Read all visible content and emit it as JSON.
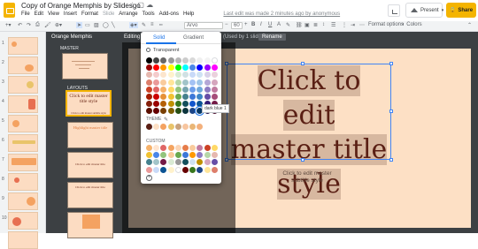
{
  "app": {
    "doc_title": "Copy of Orange Memphis by Slidesgo",
    "menu": [
      "File",
      "Edit",
      "View",
      "Insert",
      "Format",
      "Slide",
      "Arrange",
      "Tools",
      "Add-ons",
      "Help"
    ],
    "last_edit": "Last edit was made 2 minutes ago by anonymous",
    "present_label": "Present",
    "share_label": "Share"
  },
  "toolbar": {
    "font": "Arvo",
    "font_size": "60",
    "format_options": "Format options",
    "colors": "Colors"
  },
  "slides": {
    "numbers": [
      "1",
      "2",
      "3",
      "4",
      "5",
      "6",
      "7",
      "8",
      "9",
      "10"
    ]
  },
  "master": {
    "name": "Orange Memphis",
    "editing_prefix": "Editing",
    "used_text": "(Used by 1 slide)",
    "rename_label": "Rename",
    "section_master": "MASTER",
    "section_layouts": "LAYOUTS",
    "thumb_title": "Click to edit master title style",
    "thumb_subtitle": "Click to edit master subtitle style",
    "thumb_text": "Click to edit master title",
    "thumb_highlight": "Highlight master title"
  },
  "slide": {
    "title_lines": [
      "Click to edit",
      "master title",
      "style"
    ],
    "subtitle_lines": [
      "Click to edit master",
      "subtitle style"
    ],
    "bg_color": "#fde0c5",
    "title_color": "#5a1f14"
  },
  "color_picker": {
    "tab_solid": "Solid",
    "tab_gradient": "Gradient",
    "transparent_label": "Transparent",
    "theme_label": "THEME",
    "custom_label": "CUSTOM",
    "tooltip": "dark blue 1",
    "grid": [
      [
        "#000000",
        "#434343",
        "#666666",
        "#999999",
        "#b7b7b7",
        "#cccccc",
        "#d9d9d9",
        "#efefef",
        "#f3f3f3",
        "#ffffff"
      ],
      [
        "#980000",
        "#ff0000",
        "#ff9900",
        "#ffff00",
        "#00ff00",
        "#00ffff",
        "#4a86e8",
        "#0000ff",
        "#9900ff",
        "#ff00ff"
      ],
      [
        "#e6b8af",
        "#f4cccc",
        "#fce5cd",
        "#fff2cc",
        "#d9ead3",
        "#d0e0e3",
        "#c9daf8",
        "#cfe2f3",
        "#d9d2e9",
        "#ead1dc"
      ],
      [
        "#dd7e6b",
        "#ea9999",
        "#f9cb9c",
        "#ffe599",
        "#b6d7a8",
        "#a2c4c9",
        "#a4c2f4",
        "#9fc5e8",
        "#b4a7d6",
        "#d5a6bd"
      ],
      [
        "#cc4125",
        "#e06666",
        "#f6b26b",
        "#ffd966",
        "#93c47d",
        "#76a5af",
        "#6d9eeb",
        "#6fa8dc",
        "#8e7cc3",
        "#c27ba0"
      ],
      [
        "#a61c00",
        "#cc0000",
        "#e69138",
        "#f1c232",
        "#6aa84f",
        "#45818e",
        "#3c78d8",
        "#3d85c6",
        "#674ea7",
        "#a64d79"
      ],
      [
        "#85200c",
        "#990000",
        "#b45f06",
        "#bf9000",
        "#38761d",
        "#134f5c",
        "#1155cc",
        "#0b5394",
        "#351c75",
        "#741b47"
      ],
      [
        "#5b0f00",
        "#660000",
        "#783f04",
        "#7f6000",
        "#274e13",
        "#0c343d",
        "#1c4587",
        "#073763",
        "#20124d",
        "#4c1130"
      ]
    ],
    "theme": [
      "#5a1f14",
      "#fde0c5",
      "#f4a261",
      "#e9c46a",
      "#c9a27c",
      "#f7c59f",
      "#eab676",
      "#f3b07c"
    ],
    "custom": [
      [
        "#f6b26b",
        "#ffe5d0",
        "#e06666",
        "#f4a460",
        "#fcd5b5",
        "#e67c4a",
        "#f9cb9c",
        "#c27ba0",
        "#cc4125",
        "#ffd966"
      ],
      [
        "#f1c232",
        "#4a86e8",
        "#93c47d",
        "#f9cb9c",
        "#6aa84f",
        "#3c78d8",
        "#ff9900",
        "#8e7cc3",
        "#b6d7a8",
        "#e6b8af"
      ],
      [
        "#45818e",
        "#a2c4c9",
        "#741b47",
        "#d9ead3",
        "#999999",
        "#134f5c",
        "#cfe2f3",
        "#bf9000",
        "#d5a6bd",
        "#674ea7"
      ],
      [
        "#ea9999",
        "#c9daf8",
        "#0b5394",
        "#fff2cc",
        "#ffffff",
        "#660000",
        "#38761d",
        "#1c4587",
        "#ffe599",
        "#dd7e6b"
      ]
    ]
  }
}
